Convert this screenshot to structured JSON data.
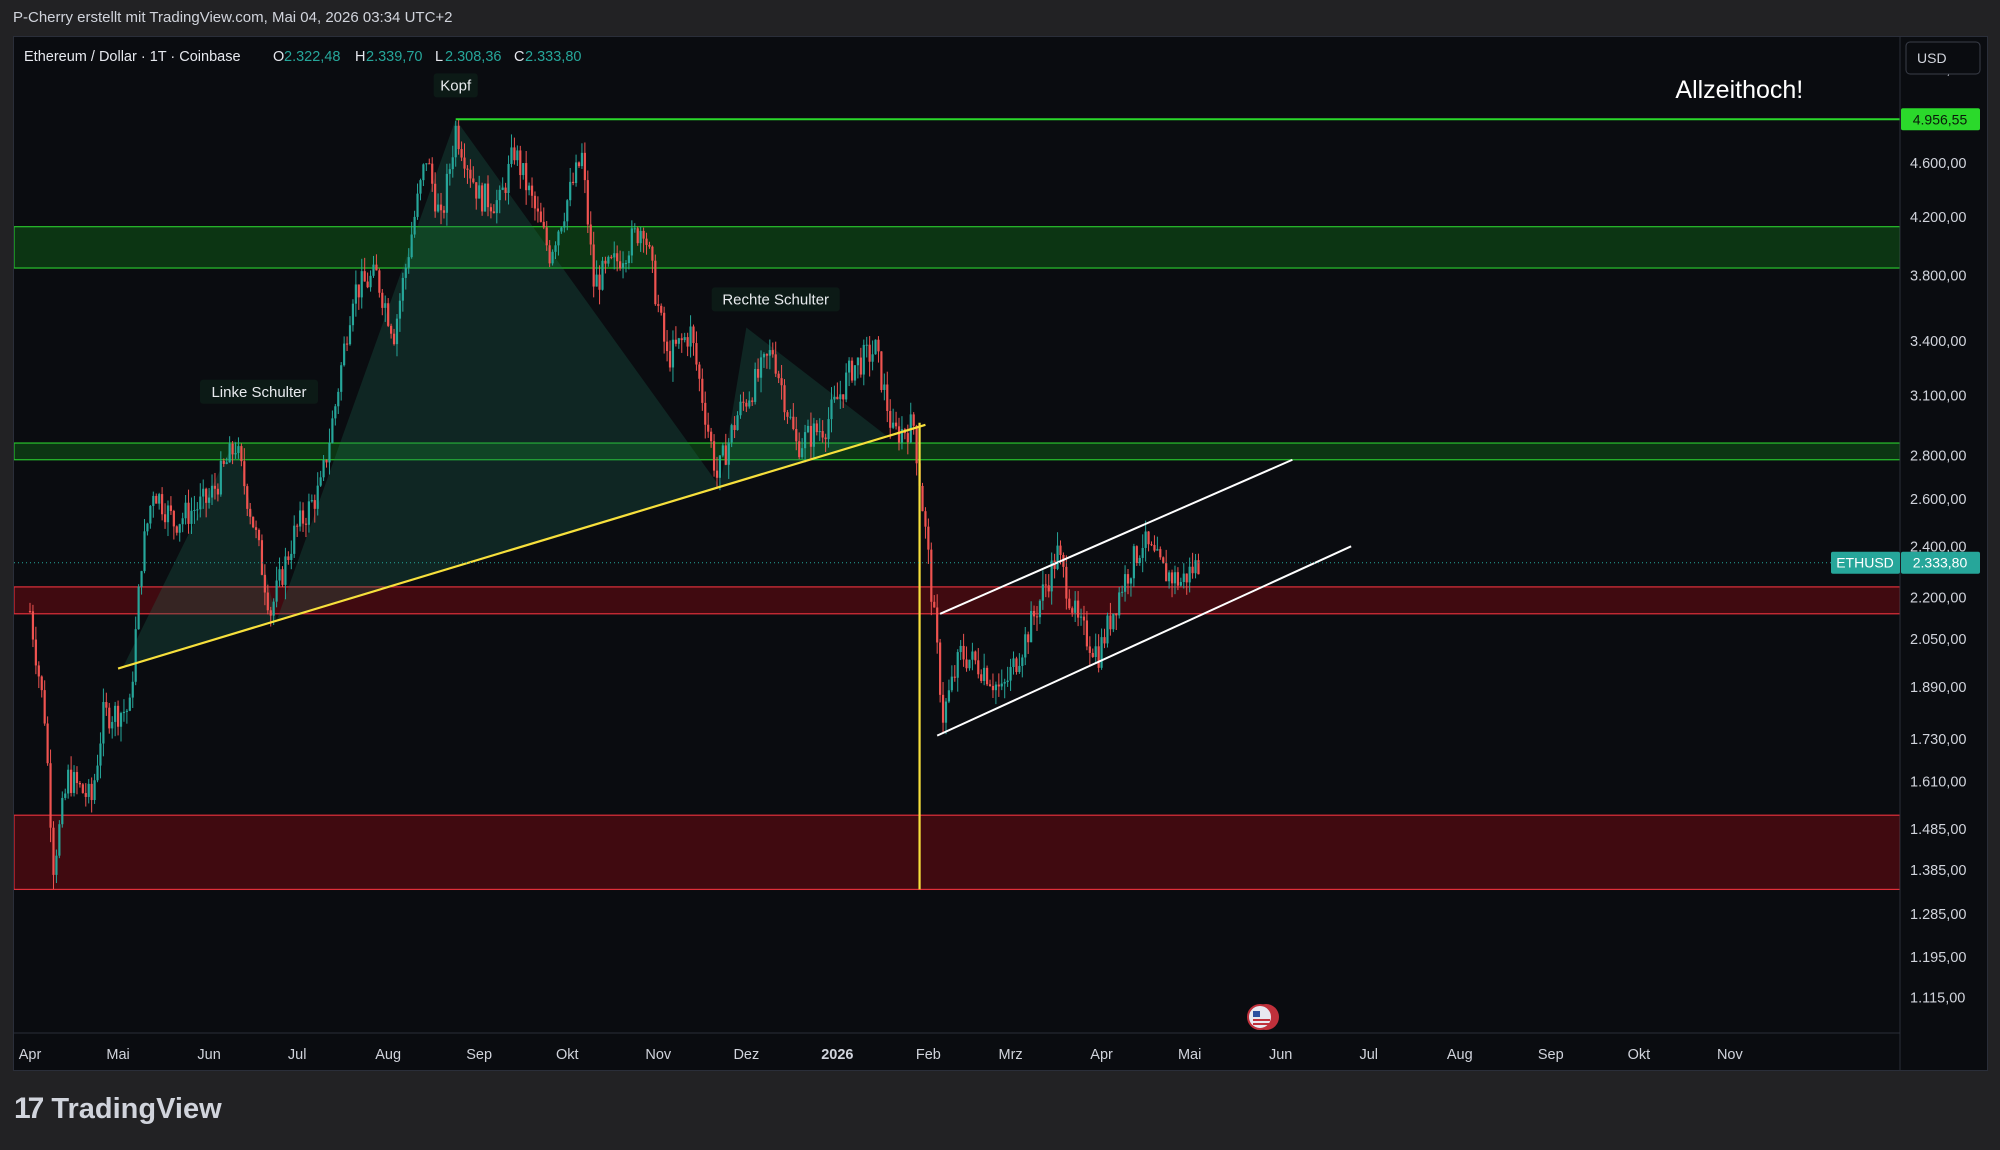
{
  "header": {
    "text": "P-Cherry erstellt mit TradingView.com, Mai 04, 2026 03:34 UTC+2"
  },
  "legend": {
    "symbol": "Ethereum / Dollar · 1T · Coinbase",
    "o_label": "O",
    "o_value": "2.322,48",
    "h_label": "H",
    "h_value": "2.339,70",
    "l_label": "L",
    "l_value": "2.308,36",
    "c_label": "C",
    "c_value": "2.333,80"
  },
  "currency_button": "USD",
  "annotations": {
    "kopf": "Kopf",
    "linke_schulter": "Linke Schulter",
    "rechte_schulter": "Rechte Schulter",
    "allzeithoch": "Allzeithoch!"
  },
  "price_tags": {
    "ath": "4.956,55",
    "symbol": "ETHUSD",
    "last": "2.333,80"
  },
  "colors": {
    "up": "#26a69a",
    "down": "#ef5350",
    "neckline": "#f7e03c",
    "ath_line": "#2bd92b",
    "support_zone": "#0d3d14",
    "resistance_zone": "#4a0a10"
  },
  "footer": {
    "brand": "TradingView",
    "logo_icon": "tradingview-logo-icon"
  },
  "chart_data": {
    "type": "candlestick",
    "title": "Ethereum / Dollar · 1T · Coinbase",
    "y_scale": "log",
    "ylim": [
      1050,
      5700
    ],
    "y_ticks": [
      5400,
      4600,
      4200,
      3800,
      3400,
      3100,
      2800,
      2600,
      2400,
      2200,
      2050,
      1890,
      1730,
      1610,
      1485,
      1385,
      1285,
      1195,
      1115
    ],
    "y_tick_labels": [
      "5.400,00",
      "4.600,00",
      "4.200,00",
      "3.800,00",
      "3.400,00",
      "3.100,00",
      "2.800,00",
      "2.600,00",
      "2.400,00",
      "2.200,00",
      "2.050,00",
      "1.890,00",
      "1.730,00",
      "1.610,00",
      "1.485,00",
      "1.385,00",
      "1.285,00",
      "1.195,00",
      "1.115,00"
    ],
    "x_range": [
      "2025-04-01",
      "2026-11-30"
    ],
    "x_ticks": [
      {
        "label": "Apr",
        "date": "2025-04-01"
      },
      {
        "label": "Mai",
        "date": "2025-05-01"
      },
      {
        "label": "Jun",
        "date": "2025-06-01"
      },
      {
        "label": "Jul",
        "date": "2025-07-01"
      },
      {
        "label": "Aug",
        "date": "2025-08-01"
      },
      {
        "label": "Sep",
        "date": "2025-09-01"
      },
      {
        "label": "Okt",
        "date": "2025-10-01"
      },
      {
        "label": "Nov",
        "date": "2025-11-01"
      },
      {
        "label": "Dez",
        "date": "2025-12-01"
      },
      {
        "label": "2026",
        "date": "2026-01-01",
        "bold": true
      },
      {
        "label": "Feb",
        "date": "2026-02-01"
      },
      {
        "label": "Mrz",
        "date": "2026-03-01"
      },
      {
        "label": "Apr",
        "date": "2026-04-01"
      },
      {
        "label": "Mai",
        "date": "2026-05-01"
      },
      {
        "label": "Jun",
        "date": "2026-06-01"
      },
      {
        "label": "Jul",
        "date": "2026-07-01"
      },
      {
        "label": "Aug",
        "date": "2026-08-01"
      },
      {
        "label": "Sep",
        "date": "2026-09-01"
      },
      {
        "label": "Okt",
        "date": "2026-10-01"
      },
      {
        "label": "Nov",
        "date": "2026-11-01"
      }
    ],
    "price_path": [
      {
        "date": "2025-04-01",
        "price": 2150
      },
      {
        "date": "2025-04-06",
        "price": 1800
      },
      {
        "date": "2025-04-09",
        "price": 1400
      },
      {
        "date": "2025-04-14",
        "price": 1620
      },
      {
        "date": "2025-04-22",
        "price": 1560
      },
      {
        "date": "2025-04-26",
        "price": 1800
      },
      {
        "date": "2025-05-05",
        "price": 1820
      },
      {
        "date": "2025-05-09",
        "price": 2350
      },
      {
        "date": "2025-05-13",
        "price": 2650
      },
      {
        "date": "2025-05-20",
        "price": 2500
      },
      {
        "date": "2025-06-01",
        "price": 2600
      },
      {
        "date": "2025-06-10",
        "price": 2850
      },
      {
        "date": "2025-06-16",
        "price": 2500
      },
      {
        "date": "2025-06-22",
        "price": 2150
      },
      {
        "date": "2025-06-30",
        "price": 2450
      },
      {
        "date": "2025-07-09",
        "price": 2650
      },
      {
        "date": "2025-07-14",
        "price": 3050
      },
      {
        "date": "2025-07-20",
        "price": 3700
      },
      {
        "date": "2025-07-28",
        "price": 3800
      },
      {
        "date": "2025-08-03",
        "price": 3450
      },
      {
        "date": "2025-08-10",
        "price": 4200
      },
      {
        "date": "2025-08-14",
        "price": 4650
      },
      {
        "date": "2025-08-19",
        "price": 4150
      },
      {
        "date": "2025-08-24",
        "price": 4880
      },
      {
        "date": "2025-09-01",
        "price": 4350
      },
      {
        "date": "2025-09-08",
        "price": 4300
      },
      {
        "date": "2025-09-13",
        "price": 4700
      },
      {
        "date": "2025-09-25",
        "price": 3950
      },
      {
        "date": "2025-10-06",
        "price": 4650
      },
      {
        "date": "2025-10-10",
        "price": 3750
      },
      {
        "date": "2025-10-18",
        "price": 3900
      },
      {
        "date": "2025-10-27",
        "price": 4150
      },
      {
        "date": "2025-11-04",
        "price": 3300
      },
      {
        "date": "2025-11-12",
        "price": 3450
      },
      {
        "date": "2025-11-21",
        "price": 2700
      },
      {
        "date": "2025-11-28",
        "price": 3000
      },
      {
        "date": "2025-12-10",
        "price": 3350
      },
      {
        "date": "2025-12-18",
        "price": 2850
      },
      {
        "date": "2025-12-28",
        "price": 2950
      },
      {
        "date": "2026-01-06",
        "price": 3250
      },
      {
        "date": "2026-01-14",
        "price": 3350
      },
      {
        "date": "2026-01-20",
        "price": 2900
      },
      {
        "date": "2026-01-27",
        "price": 2950
      },
      {
        "date": "2026-02-01",
        "price": 2350
      },
      {
        "date": "2026-02-06",
        "price": 1800
      },
      {
        "date": "2026-02-12",
        "price": 2000
      },
      {
        "date": "2026-02-20",
        "price": 1950
      },
      {
        "date": "2026-02-26",
        "price": 1870
      },
      {
        "date": "2026-03-06",
        "price": 2050
      },
      {
        "date": "2026-03-17",
        "price": 2370
      },
      {
        "date": "2026-03-24",
        "price": 2100
      },
      {
        "date": "2026-03-31",
        "price": 2000
      },
      {
        "date": "2026-04-08",
        "price": 2250
      },
      {
        "date": "2026-04-15",
        "price": 2420
      },
      {
        "date": "2026-04-22",
        "price": 2300
      },
      {
        "date": "2026-04-28",
        "price": 2260
      },
      {
        "date": "2026-05-04",
        "price": 2333.8
      }
    ],
    "current_price": 2333.8,
    "ohlc_last": {
      "open": 2322.48,
      "high": 2339.7,
      "low": 2308.36,
      "close": 2333.8
    },
    "zones": [
      {
        "kind": "support",
        "low": 3850,
        "high": 4130
      },
      {
        "kind": "support",
        "low": 2780,
        "high": 2860
      },
      {
        "kind": "resistance",
        "low": 2140,
        "high": 2240
      },
      {
        "kind": "resistance",
        "low": 1340,
        "high": 1520
      }
    ],
    "horizontal_lines": [
      {
        "name": "ath",
        "price": 4956.55,
        "from": "2025-08-24"
      }
    ],
    "trendlines": [
      {
        "name": "neckline",
        "from": {
          "date": "2025-05-01",
          "price": 1950
        },
        "to": {
          "date": "2026-01-31",
          "price": 2950
        }
      },
      {
        "name": "channel-upper",
        "from": {
          "date": "2026-02-05",
          "price": 2140
        },
        "to": {
          "date": "2026-06-05",
          "price": 2780
        }
      },
      {
        "name": "channel-lower",
        "from": {
          "date": "2026-02-04",
          "price": 1740
        },
        "to": {
          "date": "2026-06-25",
          "price": 2400
        }
      }
    ],
    "vertical_lines": [
      {
        "name": "breakdown-target",
        "date": "2026-01-29",
        "from_price": 2960,
        "to_price": 1340
      }
    ],
    "pattern_points": [
      {
        "name": "left-shoulder",
        "date": "2025-06-10",
        "price": 2880
      },
      {
        "name": "head",
        "date": "2025-08-24",
        "price": 4956
      },
      {
        "name": "right-shoulder",
        "date": "2025-12-01",
        "price": 3480
      }
    ],
    "label_anchors": [
      {
        "name": "kopf",
        "date": "2025-08-24",
        "price": 5250
      },
      {
        "name": "linke-schulter",
        "date": "2025-06-18",
        "price": 3120
      },
      {
        "name": "rechte-schulter",
        "date": "2025-12-11",
        "price": 3650
      },
      {
        "name": "allzeithoch",
        "date": "2026-11-26",
        "price": 5220
      }
    ]
  }
}
